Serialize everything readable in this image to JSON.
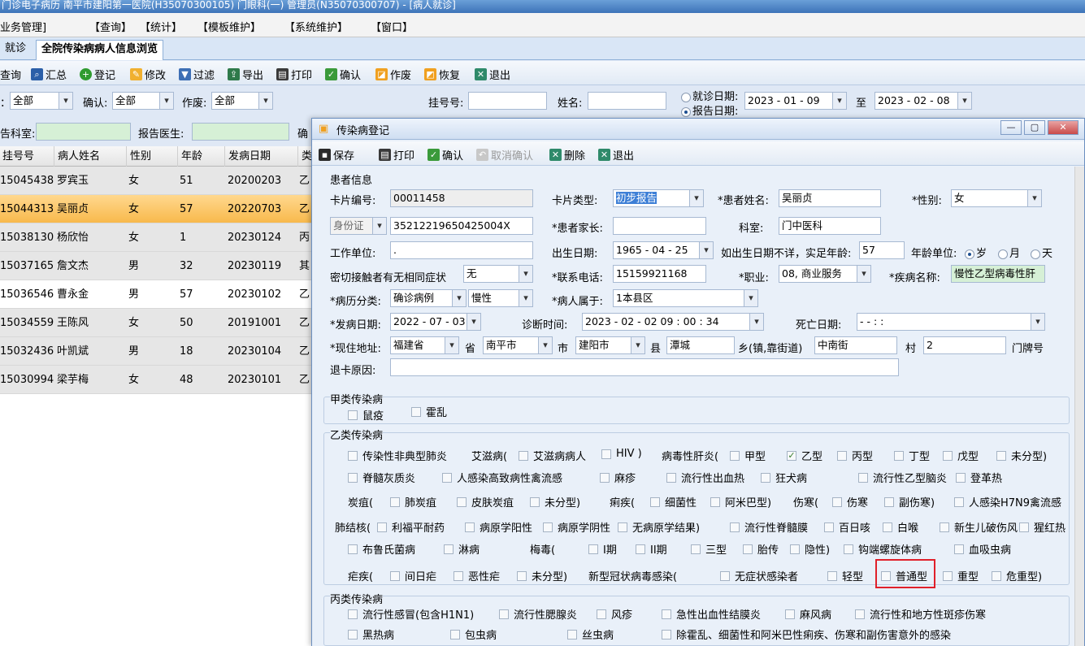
{
  "window": {
    "title": "门诊电子病历  南平市建阳第一医院(H35070300105)  门眼科(一)  管理员(N35070300707) - [病人就诊]"
  },
  "menu": [
    "业务管理]",
    "【查询】",
    "【统计】",
    "【模板维护】",
    "【系统维护】",
    "【窗口】"
  ],
  "tabs": {
    "first": "就诊",
    "second": "全院传染病病人信息浏览"
  },
  "toolbar": [
    "查询",
    "汇总",
    "登记",
    "修改",
    "过滤",
    "导出",
    "打印",
    "确认",
    "作废",
    "恢复",
    "退出"
  ],
  "filter": {
    "status_label": "：",
    "status_value": "全部",
    "confirm_label": "确认:",
    "confirm_value": "全部",
    "void_label": "作废:",
    "void_value": "全部",
    "regno_label": "挂号号:",
    "regno_value": "",
    "name_label": "姓名:",
    "name_value": "",
    "visit_date_label": "就诊日期:",
    "report_date_label": "报告日期:",
    "date_from": "2023 - 01 - 09",
    "to_label": "至",
    "date_to": "2023 - 02 - 08",
    "dept_label": "告科室:",
    "doctor_label": "报告医生:",
    "extra_label": "确"
  },
  "grid": {
    "headers": [
      "挂号号",
      "病人姓名",
      "性别",
      "年龄",
      "发病日期",
      "类"
    ],
    "rows": [
      [
        "15045438",
        "罗宾玉",
        "女",
        "51",
        "20200203",
        "乙"
      ],
      [
        "15044313",
        "吴丽贞",
        "女",
        "57",
        "20220703",
        "乙"
      ],
      [
        "15038130",
        "杨欣怡",
        "女",
        "1",
        "20230124",
        "丙"
      ],
      [
        "15037165",
        "詹文杰",
        "男",
        "32",
        "20230119",
        "其"
      ],
      [
        "15036546",
        "曹永金",
        "男",
        "57",
        "20230102",
        "乙"
      ],
      [
        "15034559",
        "王陈风",
        "女",
        "50",
        "20191001",
        "乙"
      ],
      [
        "15032436",
        "叶凯斌",
        "男",
        "18",
        "20230104",
        "乙"
      ],
      [
        "15030994",
        "梁芋梅",
        "女",
        "48",
        "20230101",
        "乙"
      ]
    ]
  },
  "dialog": {
    "title": "传染病登记",
    "toolbar": {
      "save": "保存",
      "print": "打印",
      "confirm": "确认",
      "cancel_confirm": "取消确认",
      "delete": "删除",
      "exit": "退出"
    },
    "patient_section": "患者信息",
    "card_no_label": "卡片编号:",
    "card_no": "00011458",
    "card_type_label": "卡片类型:",
    "card_type": "初步报告",
    "patient_name_label": "*患者姓名:",
    "patient_name": "吴丽贞",
    "gender_label": "*性别:",
    "gender": "女",
    "id_type": "身份证",
    "id_no": "35212219650425004X",
    "parent_label": "*患者家长:",
    "parent": "",
    "dept_label": "科室:",
    "dept": "门中医科",
    "workplace_label": "工作单位:",
    "workplace": ".",
    "birth_label": "出生日期:",
    "birth": "1965 - 04 - 25",
    "age_hint": "如出生日期不详，实足年龄:",
    "age": "57",
    "age_unit_label": "年龄单位:",
    "age_units": [
      "岁",
      "月",
      "天"
    ],
    "contact_label": "密切接触者有无相同症状",
    "contact": "无",
    "phone_label": "*联系电话:",
    "phone": "15159921168",
    "job_label": "*职业:",
    "job": "08, 商业服务",
    "disease_label": "*疾病名称:",
    "disease": "慢性乙型病毒性肝",
    "class_label": "*病历分类:",
    "class1": "确诊病例",
    "class2": "慢性",
    "belong_label": "*病人属于:",
    "belong": "1本县区",
    "onset_label": "*发病日期:",
    "onset": "2022 - 07 - 03",
    "diag_time_label": "诊断时间:",
    "diag_time": "2023 - 02 - 02    09 : 00 : 34",
    "death_label": "死亡日期:",
    "death": "-      -              :        :",
    "addr_label": "*现住地址:",
    "province": "福建省",
    "province_unit": "省",
    "city": "南平市",
    "city_unit": "市",
    "county": "建阳市",
    "county_unit": "县",
    "town": "潭城",
    "town_unit": "乡(镇,靠街道)",
    "street": "中南街",
    "village_unit": "村",
    "number": "2",
    "number_unit": "门牌号",
    "reject_label": "退卡原因:",
    "reject": ""
  },
  "class_a": {
    "title": "甲类传染病",
    "items": [
      "鼠疫",
      "霍乱"
    ]
  },
  "class_b": {
    "title": "乙类传染病",
    "row1": {
      "sars": "传染性非典型肺炎",
      "aids_label": "艾滋病(",
      "aids_patient": "艾滋病病人",
      "hiv": "HIV )",
      "hep_label": "病毒性肝炎(",
      "hep_a": "甲型",
      "hep_b": "乙型",
      "hep_c": "丙型",
      "hep_d": "丁型",
      "hep_e": "戊型",
      "hep_u": "未分型)"
    },
    "row2": [
      "脊髓灰质炎",
      "人感染高致病性禽流感",
      "麻疹",
      "流行性出血热",
      "狂犬病",
      "流行性乙型脑炎",
      "登革热"
    ],
    "row3": {
      "anthrax_label": "炭疽(",
      "anthrax": [
        "肺炭疽",
        "皮肤炭疽",
        "未分型)"
      ],
      "dys_label": "痢疾(",
      "dys": [
        "细菌性",
        "阿米巴型)"
      ],
      "typhoid_label": "伤寒(",
      "typhoid": [
        "伤寒",
        "副伤寒)",
        "人感染H7N9禽流感"
      ]
    },
    "row4": {
      "tb_label": "肺结核(",
      "tb": [
        "利福平耐药",
        "病原学阳性",
        "病原学阴性",
        "无病原学结果)",
        "流行性脊髓膜",
        "百日咳",
        "白喉",
        "新生儿破伤风",
        "猩红热"
      ]
    },
    "row5": {
      "brucella": "布鲁氏菌病",
      "gonorrhea": "淋病",
      "syphilis_label": "梅毒(",
      "syphilis": [
        "I期",
        "II期",
        "三型",
        "胎传",
        "隐性)"
      ],
      "lepto": "钩端螺旋体病",
      "schisto": "血吸虫病"
    },
    "row6": {
      "malaria_label": "疟疾(",
      "malaria": [
        "间日疟",
        "恶性疟",
        "未分型)"
      ],
      "covid_label": "新型冠状病毒感染(",
      "covid": [
        "无症状感染者",
        "轻型",
        "普通型",
        "重型",
        "危重型)"
      ]
    }
  },
  "class_c": {
    "title": "丙类传染病",
    "row1": [
      "流行性感冒(包含H1N1)",
      "流行性腮腺炎",
      "风疹",
      "急性出血性结膜炎",
      "麻风病",
      "流行性和地方性斑疹伤寒"
    ],
    "row2": [
      "黑热病",
      "包虫病",
      "丝虫病",
      "除霍乱、细菌性和阿米巴性痢疾、伤寒和副伤害意外的感染"
    ]
  }
}
